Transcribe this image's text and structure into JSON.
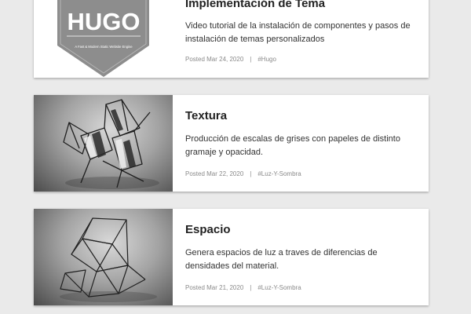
{
  "posts": [
    {
      "title": "Implementación de Tema",
      "description": "Video tutorial de la instalación de componentes y pasos de instalación de temas personalizados",
      "posted": "Posted Mar 24, 2020",
      "separator": "|",
      "tag": "#Hugo",
      "image": {
        "kind": "logo",
        "logo_text": "HUGO",
        "logo_subtext": "A Fast & Modern Static Website Engine"
      }
    },
    {
      "title": "Textura",
      "description": "Producción de escalas de grises con papeles de distinto gramaje y opacidad.",
      "posted": "Posted Mar 22, 2020",
      "separator": "|",
      "tag": "#Luz-Y-Sombra",
      "image": {
        "kind": "photo"
      }
    },
    {
      "title": "Espacio",
      "description": "Genera espacios de luz a traves de diferencias de densidades del material.",
      "posted": "Posted Mar 21, 2020",
      "separator": "|",
      "tag": "#Luz-Y-Sombra",
      "image": {
        "kind": "photo"
      }
    }
  ],
  "colors": {
    "page_background": "#eaeaea",
    "card_background": "#ffffff",
    "title": "#222222",
    "meta": "#8a8a8a",
    "logo_fill": "#8d8d8d"
  }
}
